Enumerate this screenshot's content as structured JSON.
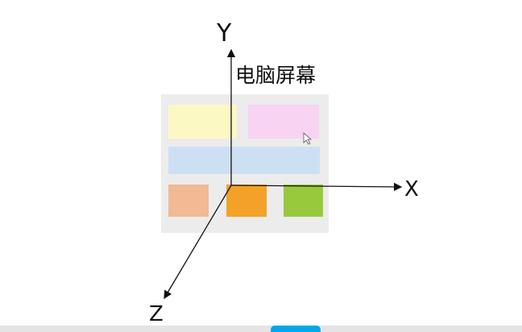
{
  "labels": {
    "y_axis": "Y",
    "x_axis": "X",
    "z_axis": "Z",
    "screen": "电脑屏幕"
  },
  "colors": {
    "panel": "#ececec",
    "yellow": "#fcf8c4",
    "pink": "#f9d3f2",
    "blue": "#cde0f3",
    "light_orange": "#f1b994",
    "orange": "#f3a128",
    "green": "#98c93c",
    "axis": "#111111"
  }
}
